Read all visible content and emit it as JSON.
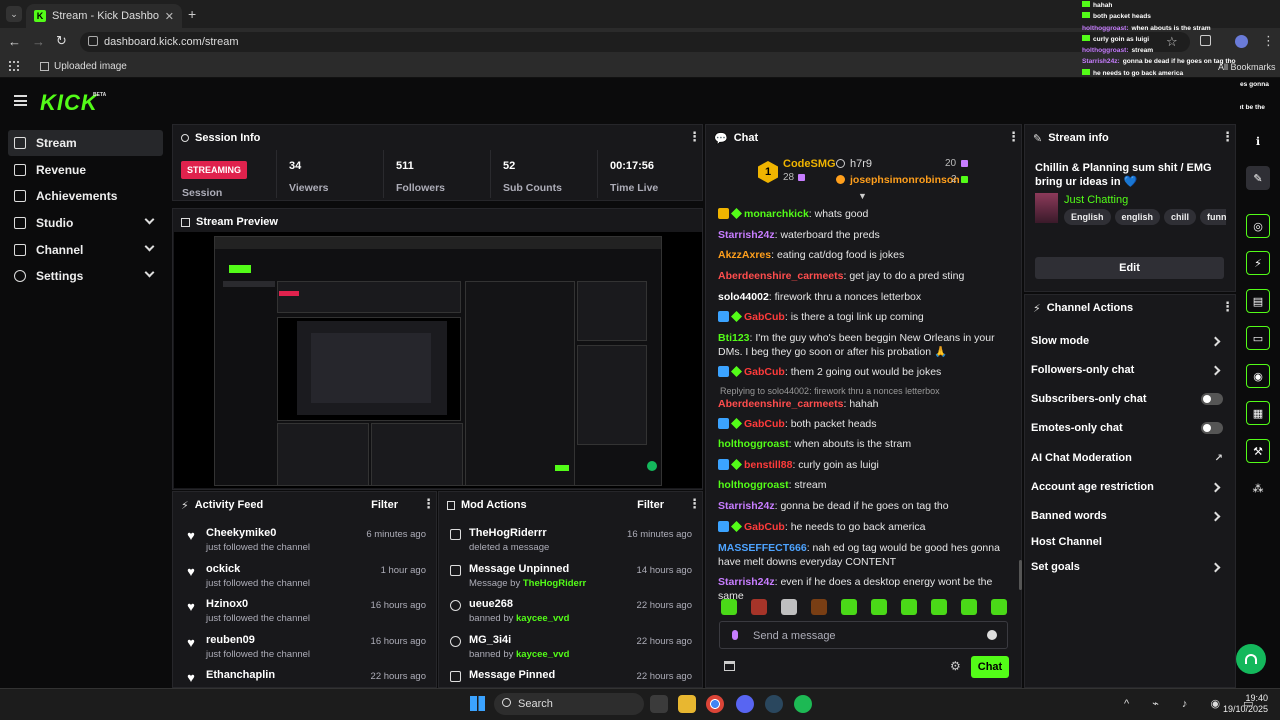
{
  "browser": {
    "tab_title": "Stream - Kick Dashboard",
    "url": "dashboard.kick.com/stream",
    "bookmark": "Uploaded image",
    "all_bookmarks": "All Bookmarks"
  },
  "overlay_chat": [
    {
      "user": "",
      "text": "hahah"
    },
    {
      "user": "",
      "text": "both packet heads"
    },
    {
      "user": "holthoggroast:",
      "text": "when abouts is the stram"
    },
    {
      "user": "",
      "text": "curly goin as luigi"
    },
    {
      "user": "holthoggroast:",
      "text": "stream"
    },
    {
      "user": "Starrish24z:",
      "text": "gonna be dead if he goes on tag tho"
    },
    {
      "user": "",
      "text": "he needs to go back america"
    },
    {
      "user": "MASSEFFECT666:",
      "text": "nah ed og tag would be good hes gonna"
    },
    {
      "user": "",
      "text": "have melt downs everyday CONTENT"
    },
    {
      "user": "Starrish24z:",
      "text": "even if he does a desktop energy wont be the"
    },
    {
      "user": "",
      "text": "same"
    }
  ],
  "app": {
    "logo": "KICK",
    "logo_beta": "BETA"
  },
  "nav": [
    {
      "label": "Stream",
      "icon": "stream-icon"
    },
    {
      "label": "Revenue",
      "icon": "revenue-icon"
    },
    {
      "label": "Achievements",
      "icon": "trophy-icon"
    },
    {
      "label": "Studio",
      "icon": "studio-icon"
    },
    {
      "label": "Channel",
      "icon": "channel-icon"
    },
    {
      "label": "Settings",
      "icon": "gear-icon"
    }
  ],
  "session": {
    "title": "Session Info",
    "status": "STREAMING",
    "status_label": "Session",
    "stats": [
      {
        "value": "34",
        "label": "Viewers"
      },
      {
        "value": "511",
        "label": "Followers"
      },
      {
        "value": "52",
        "label": "Sub Counts"
      },
      {
        "value": "00:17:56",
        "label": "Time Live"
      }
    ]
  },
  "preview": {
    "title": "Stream Preview"
  },
  "activity": {
    "title": "Activity Feed",
    "filter": "Filter",
    "items": [
      {
        "name": "Cheekymike0",
        "desc": "just followed the channel",
        "time": "6 minutes ago"
      },
      {
        "name": "ockick",
        "desc": "just followed the channel",
        "time": "1 hour ago"
      },
      {
        "name": "Hzinox0",
        "desc": "just followed the channel",
        "time": "16 hours ago"
      },
      {
        "name": "reuben09",
        "desc": "just followed the channel",
        "time": "16 hours ago"
      },
      {
        "name": "Ethanchaplin",
        "desc": "",
        "time": "22 hours ago"
      }
    ]
  },
  "mod": {
    "title": "Mod Actions",
    "filter": "Filter",
    "items": [
      {
        "name": "TheHogRiderrr",
        "pre": "deleted a message",
        "by": "",
        "time": "16 minutes ago"
      },
      {
        "name": "Message Unpinned",
        "pre": "Message by ",
        "by": "TheHogRiderr",
        "time": "14 hours ago"
      },
      {
        "name": "ueue268",
        "pre": "banned by ",
        "by": "kaycee_vvd",
        "time": "22 hours ago"
      },
      {
        "name": "MG_3i4i",
        "pre": "banned by ",
        "by": "kaycee_vvd",
        "time": "22 hours ago"
      },
      {
        "name": "Message Pinned",
        "pre": "",
        "by": "",
        "time": "22 hours ago"
      }
    ]
  },
  "chat": {
    "title": "Chat",
    "leader": {
      "rank": "1",
      "name": "CodeSMG",
      "gifts": "28",
      "user2": "h7r9",
      "user2_count": "20",
      "user3": "josephsimonrobinson",
      "user3_count": "2"
    },
    "messages": [
      {
        "user": "monarchkick",
        "text": "whats good",
        "color": "#53fc18",
        "badges": true
      },
      {
        "user": "Starrish24z",
        "text": "waterboard the preds",
        "color": "#c77dff",
        "badges": false
      },
      {
        "user": "AkzzAxres",
        "text": "eating cat/dog food is jokes",
        "color": "#ff9f1c",
        "badges": false
      },
      {
        "user": "Aberdeenshire_carmeets",
        "text": "get jay to do a pred sting",
        "color": "#ff4d4d",
        "badges": false
      },
      {
        "user": "solo44002",
        "text": "firework thru a nonces letterbox",
        "color": "#ffffff",
        "badges": false
      },
      {
        "user": "GabCub",
        "text": "is there a togi link up coming",
        "color": "#ff3b3b",
        "badges": true
      },
      {
        "user": "Bti123",
        "text": "I'm the guy who's been beggin New Orleans in your DMs. I beg they go soon or after his probation 🙏",
        "color": "#53fc18",
        "badges": false
      },
      {
        "user": "GabCub",
        "text": "them 2 going out would be jokes",
        "color": "#ff3b3b",
        "badges": true
      },
      {
        "reply": "Replying to solo44002: firework thru a nonces letterbox"
      },
      {
        "user": "Aberdeenshire_carmeets",
        "text": "hahah",
        "color": "#ff4d4d",
        "badges": false
      },
      {
        "user": "GabCub",
        "text": "both packet heads",
        "color": "#ff3b3b",
        "badges": true
      },
      {
        "user": "holthoggroast",
        "text": "when abouts is the stram",
        "color": "#53fc18",
        "badges": false
      },
      {
        "user": "benstill88",
        "text": "curly goin as luigi",
        "color": "#ff3b3b",
        "badges": true
      },
      {
        "user": "holthoggroast",
        "text": "stream",
        "color": "#53fc18",
        "badges": false
      },
      {
        "user": "Starrish24z",
        "text": "gonna be dead if he goes on tag tho",
        "color": "#c77dff",
        "badges": false
      },
      {
        "user": "GabCub",
        "text": "he needs to go back america",
        "color": "#ff3b3b",
        "badges": true
      },
      {
        "user": "MASSEFFECT666",
        "text": "nah ed og tag would be good hes gonna have melt downs everyday CONTENT",
        "color": "#4da3ff",
        "badges": false
      },
      {
        "user": "Starrish24z",
        "text": "even if he does a desktop energy wont be the same",
        "color": "#c77dff",
        "badges": false
      }
    ],
    "placeholder": "Send a message",
    "send": "Chat"
  },
  "stream_info": {
    "title": "Stream info",
    "stream_title": "Chillin & Planning sum shit / EMG bring ur ideas in 💙",
    "category": "Just Chatting",
    "tags": [
      "English",
      "english",
      "chill",
      "funny"
    ],
    "edit": "Edit"
  },
  "channel_actions": {
    "title": "Channel Actions",
    "items": [
      {
        "label": "Slow mode",
        "control": "chevron"
      },
      {
        "label": "Followers-only chat",
        "control": "chevron"
      },
      {
        "label": "Subscribers-only chat",
        "control": "toggle"
      },
      {
        "label": "Emotes-only chat",
        "control": "toggle"
      },
      {
        "label": "AI Chat Moderation",
        "control": "external"
      },
      {
        "label": "Account age restriction",
        "control": "chevron"
      },
      {
        "label": "Banned words",
        "control": "chevron"
      },
      {
        "label": "Host Channel",
        "control": "none"
      },
      {
        "label": "Set goals",
        "control": "chevron"
      }
    ]
  },
  "taskbar": {
    "search": "Search",
    "time": "19:40",
    "date": "19/10/2025"
  },
  "colors": {
    "accent": "#53fc18",
    "panel": "#18181b",
    "live": "#e0224d"
  }
}
